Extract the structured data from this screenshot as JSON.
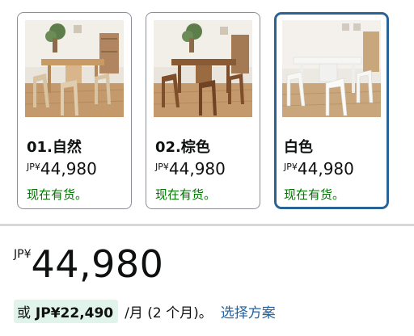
{
  "variants": [
    {
      "name": "01.自然",
      "currency": "JP¥",
      "price": "44,980",
      "stock": "现在有货。",
      "selected": false
    },
    {
      "name": "02.棕色",
      "currency": "JP¥",
      "price": "44,980",
      "stock": "现在有货。",
      "selected": false
    },
    {
      "name": "白色",
      "currency": "JP¥",
      "price": "44,980",
      "stock": "现在有货。",
      "selected": true
    }
  ],
  "price": {
    "currency": "JP¥",
    "amount": "44,980"
  },
  "installment": {
    "prefix": "或",
    "amount": "JP¥22,490",
    "period": "/月 (2 个月)。",
    "link": "选择方案"
  },
  "colors": {
    "selected_border": "#2a6496",
    "stock_green": "#007600",
    "link_blue": "#2162a1",
    "highlight_bg": "#e0f4ec"
  }
}
